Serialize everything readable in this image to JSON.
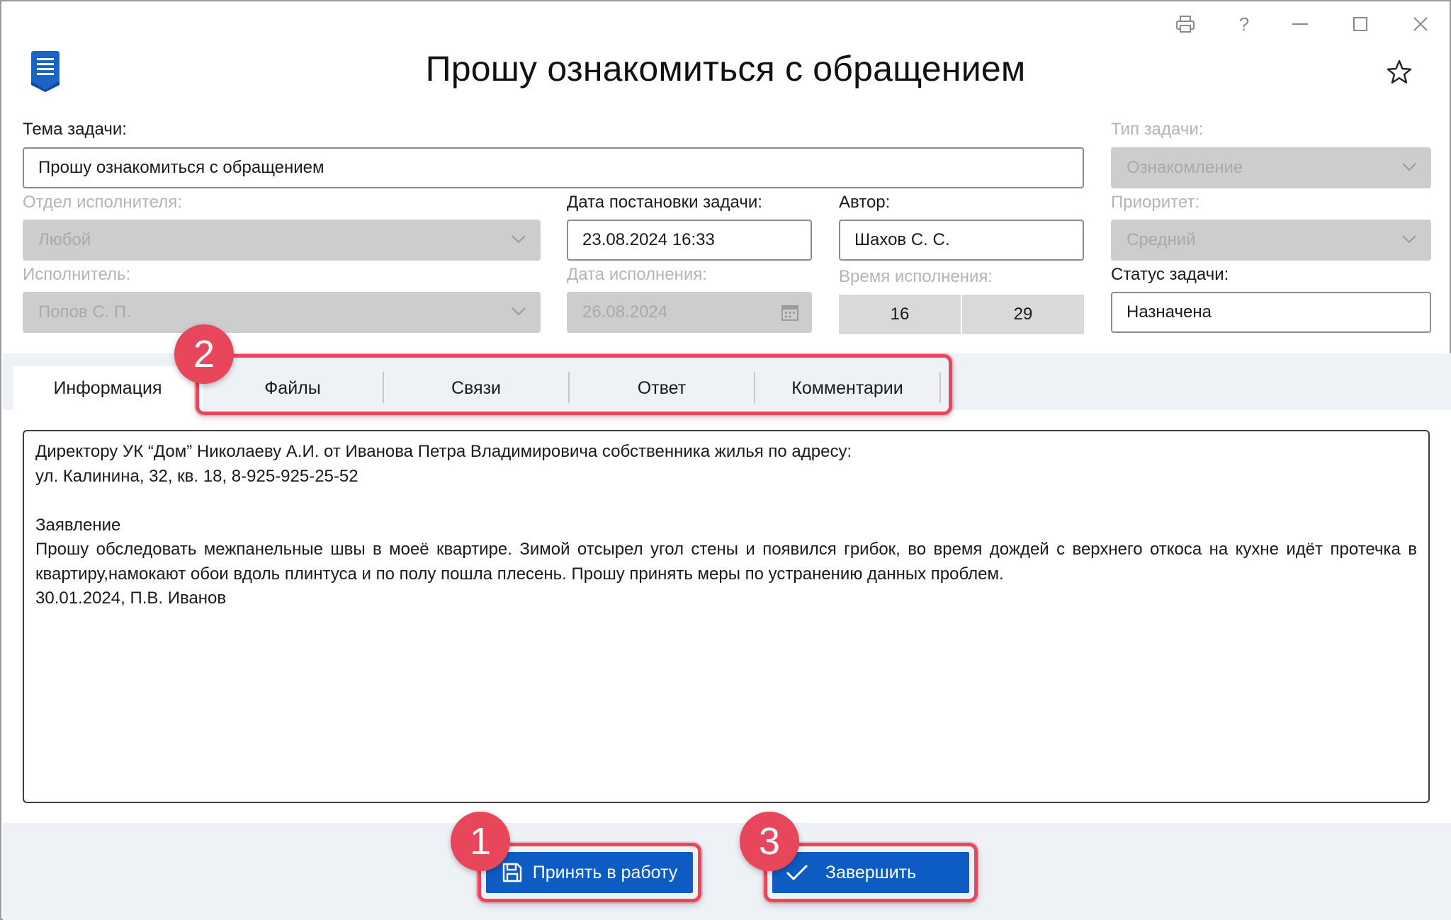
{
  "window": {
    "controls": [
      "printer-icon",
      "help-icon",
      "minimize-icon",
      "maximize-icon",
      "close-icon"
    ],
    "help_glyph": "?"
  },
  "header": {
    "title": "Прошу ознакомиться с обращением",
    "logo_icon": "document-icon",
    "favorite_icon": "star-icon"
  },
  "form": {
    "subject": {
      "label": "Тема задачи:",
      "value": "Прошу ознакомиться с обращением"
    },
    "task_type": {
      "label": "Тип задачи:",
      "value": "Ознакомление",
      "disabled": true
    },
    "department": {
      "label": "Отдел исполнителя:",
      "value": "Любой",
      "disabled": true
    },
    "set_date": {
      "label": "Дата постановки задачи:",
      "value": "23.08.2024 16:33"
    },
    "author": {
      "label": "Автор:",
      "value": "Шахов С. С."
    },
    "priority": {
      "label": "Приоритет:",
      "value": "Средний",
      "disabled": true
    },
    "executor": {
      "label": "Исполнитель:",
      "value": "Попов С. П.",
      "disabled": true
    },
    "due_date": {
      "label": "Дата исполнения:",
      "value": "26.08.2024",
      "disabled": true
    },
    "due_time": {
      "label": "Время исполнения:",
      "hours": "16",
      "minutes": "29"
    },
    "status": {
      "label": "Статус задачи:",
      "value": "Назначена"
    }
  },
  "tabs": [
    {
      "label": "Информация",
      "active": true
    },
    {
      "label": "Файлы"
    },
    {
      "label": "Связи"
    },
    {
      "label": "Ответ"
    },
    {
      "label": "Комментарии"
    }
  ],
  "content": {
    "lines": [
      "Директору УК “Дом” Николаеву А.И. от Иванова Петра Владимировича собственника жилья по адресу:",
      "ул. Калинина, 32, кв. 18, 8-925-925-25-52",
      "",
      "Заявление",
      "Прошу обследовать межпанельные швы в моеё квартире. Зимой отсырел угол стены и появился грибок, во время дождей с верхнего откоса на кухне идёт протечка в квартиру,намокают обои вдоль плинтуса и по полу пошла плесень. Прошу принять меры по устранению данных проблем.",
      "30.01.2024, П.В. Иванов"
    ]
  },
  "buttons": {
    "accept": {
      "label": "Принять в работу",
      "icon": "save-icon"
    },
    "finish": {
      "label": "Завершить",
      "icon": "checkmark-icon"
    }
  },
  "annotations": [
    "1",
    "2",
    "3"
  ],
  "colors": {
    "accent": "#0d5cc4",
    "annotation": "#e8465a",
    "disabled_field": "#cdcdcd",
    "band": "#eef2f7"
  }
}
